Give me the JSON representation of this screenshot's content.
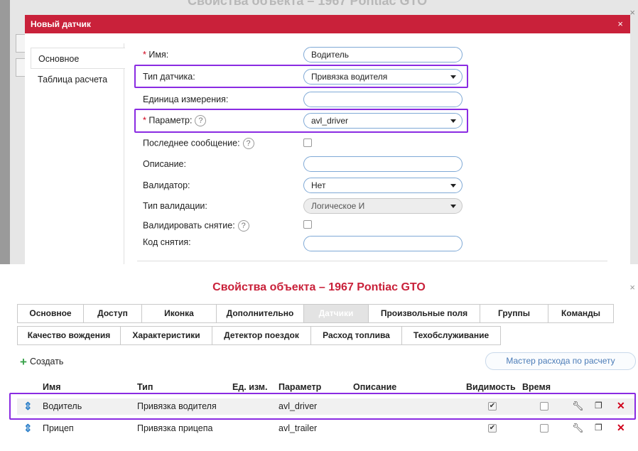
{
  "dialog": {
    "title": "Новый датчик",
    "close_icon": "×",
    "bg_window_title": "Свойства объекта – 1967 Pontiac GTO",
    "side_nav": [
      "Основное",
      "Таблица расчета"
    ],
    "fields": {
      "name": {
        "label": "Имя:",
        "value": "Водитель"
      },
      "sensor_type": {
        "label": "Тип датчика:",
        "value": "Привязка водителя"
      },
      "unit": {
        "label": "Единица измерения:",
        "value": ""
      },
      "parameter": {
        "label": "Параметр:",
        "value": "avl_driver"
      },
      "last_message": {
        "label": "Последнее сообщение:"
      },
      "description": {
        "label": "Описание:",
        "value": ""
      },
      "validator": {
        "label": "Валидатор:",
        "value": "Нет"
      },
      "validation_type": {
        "label": "Тип валидации:",
        "value": "Логическое И"
      },
      "validate_unbind": {
        "label": "Валидировать снятие:"
      },
      "unbind_code": {
        "label": "Код снятия:",
        "value": ""
      }
    },
    "required_mark": "*",
    "help_symbol": "?"
  },
  "properties": {
    "title": "Свойства объекта – 1967 Pontiac GTO",
    "close_icon": "×",
    "tabs_row1": [
      "Основное",
      "Доступ",
      "Иконка",
      "Дополнительно",
      "Датчики",
      "Произвольные поля",
      "Группы",
      "Команды"
    ],
    "tabs_row2": [
      "Качество вождения",
      "Характеристики",
      "Детектор поездок",
      "Расход топлива",
      "Техобслуживание"
    ],
    "active_tab": "Датчики",
    "create_label": "Создать",
    "wizard_label": "Мастер расхода по расчету",
    "columns": [
      "Имя",
      "Тип",
      "Ед. изм.",
      "Параметр",
      "Описание",
      "Видимость",
      "Время"
    ],
    "rows": [
      {
        "name": "Водитель",
        "type": "Привязка водителя",
        "param": "avl_driver",
        "visible": true,
        "time": false
      },
      {
        "name": "Прицеп",
        "type": "Привязка прицепа",
        "param": "avl_trailer",
        "visible": true,
        "time": false
      }
    ]
  },
  "colors": {
    "accent_red": "#c9213a",
    "highlight_purple": "#8a2be2",
    "input_border_blue": "#7fa9d6",
    "create_green": "#3aa34b",
    "sort_blue": "#2b7fc9"
  },
  "icons": {
    "help": "help-circle-icon",
    "caret": "caret-down-icon",
    "plus": "plus-icon",
    "sort": "up-down-arrow-icon",
    "edit": "wrench-icon",
    "copy": "copy-icon",
    "delete": "delete-x-icon"
  }
}
